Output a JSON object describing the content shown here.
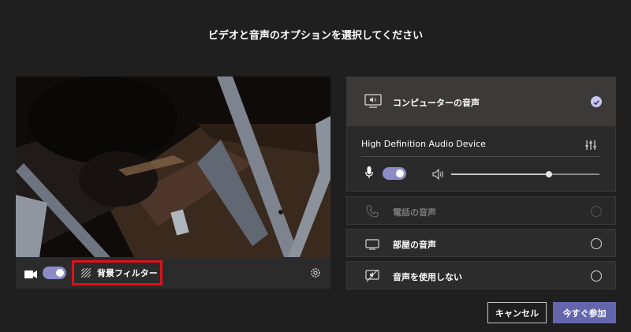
{
  "dialog": {
    "title": "ビデオと音声のオプションを選択してください"
  },
  "video_bar": {
    "camera_toggle_on": true,
    "background_filter_label": "背景フィルター"
  },
  "audio": {
    "computer": {
      "label": "コンピューターの音声",
      "selected": true,
      "device_name": "High Definition Audio Device",
      "mic_on": true,
      "volume_level": 0.66
    },
    "phone": {
      "label": "電話の音声",
      "disabled": true
    },
    "room": {
      "label": "部屋の音声"
    },
    "none": {
      "label": "音声を使用しない"
    }
  },
  "buttons": {
    "cancel": "キャンセル",
    "join": "今すぐ参加"
  },
  "colors": {
    "background": "#201f1f",
    "accent": "#6466ad",
    "toggle": "#8b8cc7",
    "highlight_border": "#e0101a"
  }
}
